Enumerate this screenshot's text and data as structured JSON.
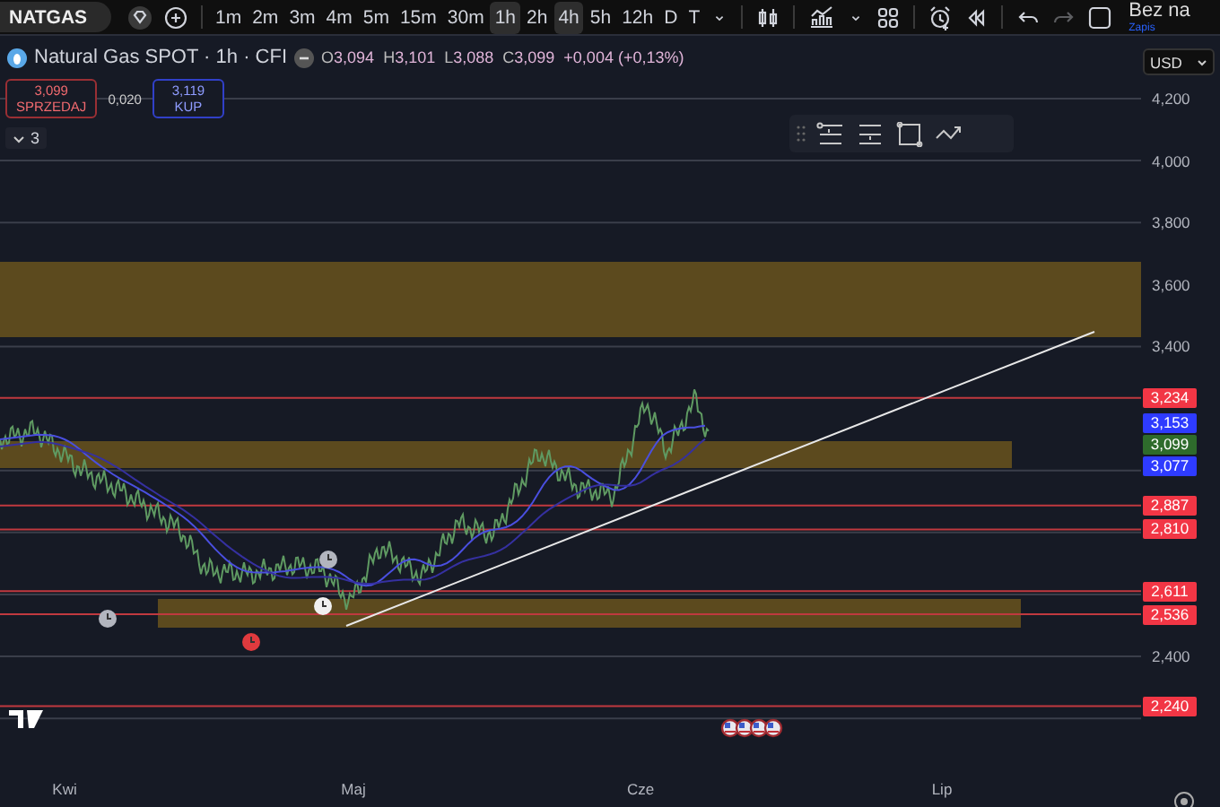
{
  "toolbar": {
    "symbol": "NATGAS",
    "timeframes": [
      {
        "label": "1m",
        "selected": false
      },
      {
        "label": "2m",
        "selected": false
      },
      {
        "label": "3m",
        "selected": false
      },
      {
        "label": "4m",
        "selected": false
      },
      {
        "label": "5m",
        "selected": false
      },
      {
        "label": "15m",
        "selected": false
      },
      {
        "label": "30m",
        "selected": false
      },
      {
        "label": "1h",
        "selected": true
      },
      {
        "label": "2h",
        "selected": false
      },
      {
        "label": "4h",
        "selected": true
      },
      {
        "label": "5h",
        "selected": false
      },
      {
        "label": "12h",
        "selected": false
      },
      {
        "label": "D",
        "selected": false
      },
      {
        "label": "T",
        "selected": false
      }
    ],
    "redo": {
      "disabled": true
    },
    "layout_name": "Bez na",
    "layout_status": "Zapis"
  },
  "legend": {
    "title": "Natural Gas SPOT · 1h · CFI",
    "values": [
      {
        "label": "O",
        "value": "3,094"
      },
      {
        "label": "H",
        "value": "3,101"
      },
      {
        "label": "L",
        "value": "3,088"
      },
      {
        "label": "C",
        "value": "3,099"
      }
    ],
    "change": "+0,004 (+0,13%)"
  },
  "trade": {
    "sell_price": "3,099",
    "sell_label": "SPRZEDAJ",
    "spread": "0,020",
    "buy_price": "3,119",
    "buy_label": "KUP"
  },
  "indicators_count": "3",
  "currency": "USD",
  "price_axis": {
    "ticks": [
      "4,200",
      "4,000",
      "3,800",
      "3,600",
      "3,400",
      "2,400"
    ],
    "badges": [
      {
        "label": "3,234",
        "color": "#f23645"
      },
      {
        "label": "3,153",
        "color": "#2e3bff"
      },
      {
        "label": "3,099",
        "color": "#2e6b2c"
      },
      {
        "label": "3,077",
        "color": "#2e3bff"
      },
      {
        "label": "2,887",
        "color": "#f23645"
      },
      {
        "label": "2,810",
        "color": "#f23645"
      },
      {
        "label": "2,611",
        "color": "#f23645"
      },
      {
        "label": "2,536",
        "color": "#f23645"
      },
      {
        "label": "2,240",
        "color": "#f23645"
      }
    ]
  },
  "time_axis": [
    "Kwi",
    "Maj",
    "Cze",
    "Lip"
  ]
}
